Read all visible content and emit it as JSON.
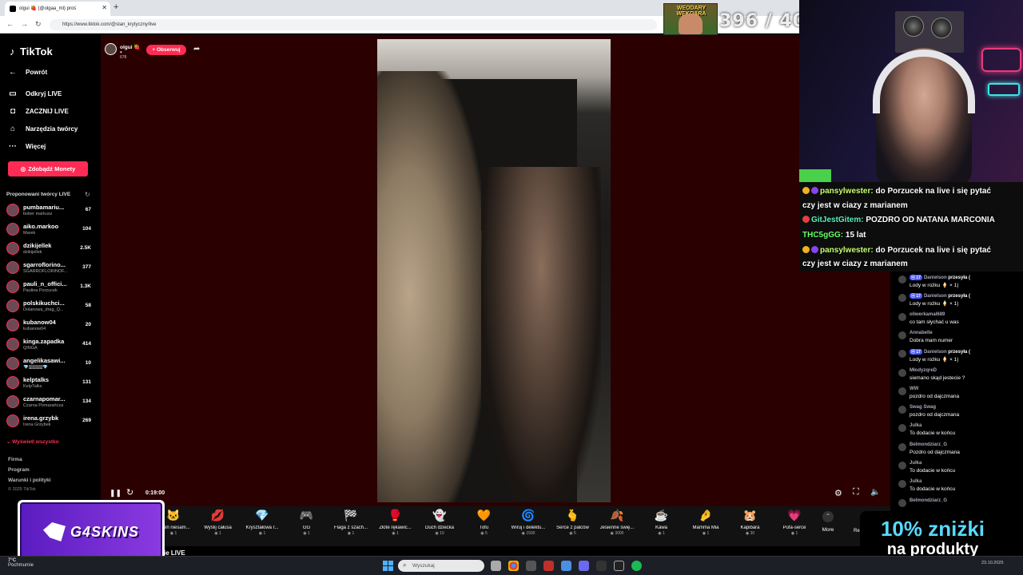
{
  "browser": {
    "tab_title": "olgui 🍓 (@olgaa_ml) proś",
    "url": "https://www.tiktok.com/@stan_krytyczny/live"
  },
  "counter": {
    "image_label": "WEODARY WEKOARA",
    "value": "396 / 400"
  },
  "sidebar": {
    "logo": "TikTok",
    "back": "Powrót",
    "nav": [
      {
        "label": "Odkryj LIVE",
        "icon": "live-icon"
      },
      {
        "label": "ZACZNIJ LIVE",
        "icon": "camera-icon"
      },
      {
        "label": "Narzędzia twórcy",
        "icon": "lightbulb-icon"
      },
      {
        "label": "Więcej",
        "icon": "more-icon"
      }
    ],
    "coins_button": "Zdobądź Monety",
    "section_title": "Proponowani twórcy LIVE",
    "creators": [
      {
        "name": "pumbamariu...",
        "sub": "bober markusz",
        "count": "67"
      },
      {
        "name": "aiko.markoo",
        "sub": "Marek",
        "count": "104"
      },
      {
        "name": "dzikijellek",
        "sub": "dzikijellek",
        "count": "2.5K"
      },
      {
        "name": "sgarroflorino...",
        "sub": "SGARROFLORINOF...",
        "count": "377"
      },
      {
        "name": "pauli_n_offici...",
        "sub": "Paulina Porzucek",
        "count": "1.3K"
      },
      {
        "name": "polskikuchci...",
        "sub": "Dolanowa_drag_Q...",
        "count": "58"
      },
      {
        "name": "kubanow04",
        "sub": "kubanow04",
        "count": "20"
      },
      {
        "name": "kinga.zapadka",
        "sub": "QINGA",
        "count": "414"
      },
      {
        "name": "angelikasawi...",
        "sub": "💎🀫🀫🀫🀫💎",
        "count": "10"
      },
      {
        "name": "kelptalks",
        "sub": "KelpTalks",
        "count": "131"
      },
      {
        "name": "czarnapomar...",
        "sub": "Czarna Pomarańcza",
        "count": "134"
      },
      {
        "name": "irena.grzybk",
        "sub": "Irena Grzybek",
        "count": "269"
      }
    ],
    "show_all": "Wyświetl wszystko",
    "footer": [
      "Firma",
      "Program",
      "Warunki i polityki"
    ],
    "copyright": "© 2025 TikTok"
  },
  "player": {
    "host_name": "olgui 🍓",
    "host_likes": "♥ 678",
    "follow": "+ Obserwuj",
    "timer": "0:19:00"
  },
  "gifts": [
    {
      "name": "Dzień niesam...",
      "price": "1",
      "icon": "🐱"
    },
    {
      "name": "Wyślij całusa",
      "price": "1",
      "icon": "💋"
    },
    {
      "name": "Kryształowa r...",
      "price": "1",
      "icon": "💎"
    },
    {
      "name": "GG",
      "price": "1",
      "icon": "🎮"
    },
    {
      "name": "Flaga z szach...",
      "price": "1",
      "icon": "🏁"
    },
    {
      "name": "Złote rękawic...",
      "price": "1",
      "icon": "🥊"
    },
    {
      "name": "Duch dziecka",
      "price": "10",
      "icon": "👻"
    },
    {
      "name": "Tofu",
      "price": "5",
      "icon": "🧡"
    },
    {
      "name": "Wiruj i delektu...",
      "price": "1500",
      "icon": "🌀"
    },
    {
      "name": "Serce z palców",
      "price": "5",
      "icon": "🫰"
    },
    {
      "name": "Jesienne świę...",
      "price": "3000",
      "icon": "🍂"
    },
    {
      "name": "Kawa",
      "price": "1",
      "icon": "☕"
    },
    {
      "name": "Mamma Mia",
      "price": "1",
      "icon": "🤌"
    },
    {
      "name": "Kapibara",
      "price": "30",
      "icon": "🐹"
    },
    {
      "name": "Pufa-serce",
      "price": "1",
      "icon": "💗"
    }
  ],
  "more": "More",
  "live_label": "ie LIVE",
  "re_label": "Re",
  "overlay_chat": [
    {
      "user": "pansylwester:",
      "text": " do Porzucek na live i się pytać",
      "color": "#c8ff70"
    },
    {
      "user": "",
      "text": "czy jest w ciazy z marianem",
      "color": "#ffffff"
    },
    {
      "user": "GitJestGitem:",
      "text": " POZDRO OD NATANA MARCONIA",
      "color": "#5af0c0"
    },
    {
      "user": "THC5gGG:",
      "text": " 15 lat",
      "color": "#6aff6a"
    },
    {
      "user": "pansylwester:",
      "text": " do Porzucek na live i się pytać",
      "color": "#c8ff70"
    },
    {
      "user": "",
      "text": "czy jest w ciazy z marianem",
      "color": "#ffffff"
    }
  ],
  "tiktok_chat": [
    {
      "user": "Danielson",
      "level": "17",
      "text_inline": " przesyła (",
      "text": "Lody w rożku 🍦 × 1)"
    },
    {
      "user": "Danielson",
      "level": "17",
      "text_inline": " przesyła (",
      "text": "Lody w rożku 🍦 × 1)"
    },
    {
      "user": "oliwerkamal689",
      "level": "",
      "text_inline": "",
      "text": "co tam słychać u was"
    },
    {
      "user": "Annabelle",
      "level": "",
      "text_inline": "",
      "text": "Dobra mam numer"
    },
    {
      "user": "Danielson",
      "level": "17",
      "text_inline": " przesyła (",
      "text": "Lody w rożku 🍦 × 1)"
    },
    {
      "user": "MłodyzqreD",
      "level": "",
      "text_inline": "",
      "text": "siemano skąd jestecie ?"
    },
    {
      "user": "WW",
      "level": "",
      "text_inline": "",
      "text": "pozdro od dajczmana"
    },
    {
      "user": "Swag Swag",
      "level": "",
      "text_inline": "",
      "text": "pozdro od dajczmana"
    },
    {
      "user": "Julka",
      "level": "",
      "text_inline": "",
      "text": "To dodacie w końcu"
    },
    {
      "user": "Belmondziarz_G",
      "level": "",
      "text_inline": "",
      "text": "Pozdro od dajczmana"
    },
    {
      "user": "Julka",
      "level": "",
      "text_inline": "",
      "text": "To dodacie w końcu"
    },
    {
      "user": "Julka",
      "level": "",
      "text_inline": "",
      "text": "To dodacie w końcu"
    },
    {
      "user": "Belmondziarz_G",
      "level": "",
      "text_inline": "",
      "text": ""
    }
  ],
  "sponsor": {
    "brand": "G4SKINS",
    "promo_line1": "10% zniżki",
    "promo_line2": "na produkty"
  },
  "taskbar": {
    "weather_temp": "7°C",
    "weather_text": "Pochmurnie",
    "search_placeholder": "Wyszukaj",
    "tray_date": "23.10.2025"
  },
  "colors": {
    "accent": "#fe2c55",
    "stage_bg": "#2a0000",
    "promo_blue": "#5ad8ff"
  }
}
